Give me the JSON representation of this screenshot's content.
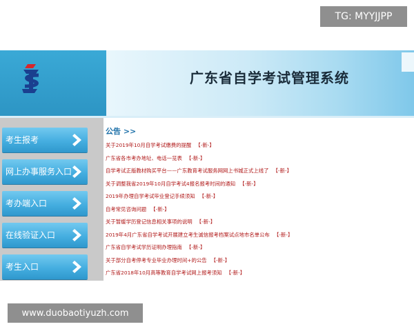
{
  "overlay": {
    "tg_label": "TG: MYYJJPP",
    "watermark_url": "www.duobaotiyuzh.com"
  },
  "header": {
    "title": "广东省自学考试管理系统"
  },
  "sidebar": {
    "items": [
      {
        "label": "考生报考",
        "icon": "chevron-right-icon"
      },
      {
        "label": "网上办事服务入口",
        "icon": "chevron-right-icon"
      },
      {
        "label": "考办端入口",
        "icon": "chevron-right-icon"
      },
      {
        "label": "在线验证入口",
        "icon": "chevron-right-icon"
      },
      {
        "label": "考生入口",
        "icon": "chevron-right-icon"
      }
    ]
  },
  "notices": {
    "heading": "公告 >>",
    "new_tag": "【-新-】",
    "items": [
      "关于2019年10月自学考试缴费的提醒",
      "广东省各市考办地址、电话一览表",
      "自学考试正版教材购买平台——广东教育考试服务网网上书城正式上线了",
      "关于调整我省2019年10月自学考试4报名报考时间的通知",
      "2019年办理自学考试毕业登记手续须知",
      "自考常见咨询问题",
      "关于暂缓学历登记信息相关事项的说明",
      "2019年4月广东省自学考试开展建立考生诚信报考档案试点地市名单公布",
      "广东省自学考试学历证明办理指南",
      "关于部分自考停考专业毕业办理时间+的公告",
      "广东省2018年10月高等教育自学考试网上报考须知"
    ]
  },
  "colors": {
    "header_blue": "#2aa0d3",
    "button_blue": "#45aee0",
    "notice_red": "#b01818",
    "heading_blue": "#1b6fa8",
    "sidebar_gray": "#c9c9c9"
  }
}
